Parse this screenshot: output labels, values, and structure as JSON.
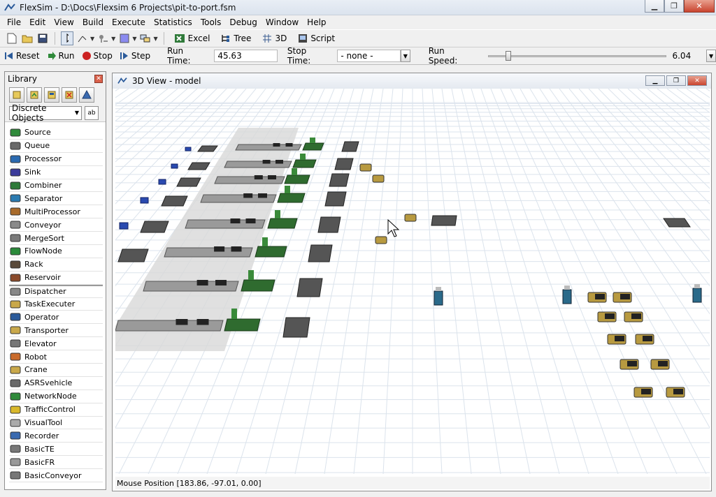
{
  "window": {
    "title": "FlexSim - D:\\Docs\\Flexsim 6 Projects\\pit-to-port.fsm"
  },
  "menu": [
    "File",
    "Edit",
    "View",
    "Build",
    "Execute",
    "Statistics",
    "Tools",
    "Debug",
    "Window",
    "Help"
  ],
  "toolbar": {
    "excel": "Excel",
    "tree": "Tree",
    "view3d": "3D",
    "script": "Script"
  },
  "run_controls": {
    "reset": "Reset",
    "run": "Run",
    "stop": "Stop",
    "step": "Step",
    "run_time_label": "Run Time:",
    "run_time_value": "45.63",
    "stop_time_label": "Stop Time:",
    "stop_time_value": "- none -",
    "run_speed_label": "Run Speed:",
    "run_speed_value": "6.04",
    "run_speed_fraction": 0.1
  },
  "library": {
    "title": "Library",
    "category": "Discrete Objects",
    "ab_label": "ab",
    "items": [
      {
        "label": "Source",
        "icon": "source-icon"
      },
      {
        "label": "Queue",
        "icon": "queue-icon"
      },
      {
        "label": "Processor",
        "icon": "processor-icon"
      },
      {
        "label": "Sink",
        "icon": "sink-icon"
      },
      {
        "label": "Combiner",
        "icon": "combiner-icon"
      },
      {
        "label": "Separator",
        "icon": "separator-icon"
      },
      {
        "label": "MultiProcessor",
        "icon": "multiprocessor-icon"
      },
      {
        "label": "Conveyor",
        "icon": "conveyor-icon"
      },
      {
        "label": "MergeSort",
        "icon": "mergesort-icon"
      },
      {
        "label": "FlowNode",
        "icon": "flownode-icon"
      },
      {
        "label": "Rack",
        "icon": "rack-icon"
      },
      {
        "label": "Reservoir",
        "icon": "reservoir-icon"
      },
      {
        "label": "Dispatcher",
        "icon": "dispatcher-icon"
      },
      {
        "label": "TaskExecuter",
        "icon": "taskexecuter-icon"
      },
      {
        "label": "Operator",
        "icon": "operator-icon"
      },
      {
        "label": "Transporter",
        "icon": "transporter-icon"
      },
      {
        "label": "Elevator",
        "icon": "elevator-icon"
      },
      {
        "label": "Robot",
        "icon": "robot-icon"
      },
      {
        "label": "Crane",
        "icon": "crane-icon"
      },
      {
        "label": "ASRSvehicle",
        "icon": "asrsvehicle-icon"
      },
      {
        "label": "NetworkNode",
        "icon": "networknode-icon"
      },
      {
        "label": "TrafficControl",
        "icon": "trafficcontrol-icon"
      },
      {
        "label": "VisualTool",
        "icon": "visualtool-icon"
      },
      {
        "label": "Recorder",
        "icon": "recorder-icon"
      },
      {
        "label": "BasicTE",
        "icon": "basicte-icon"
      },
      {
        "label": "BasicFR",
        "icon": "basicfr-icon"
      },
      {
        "label": "BasicConveyor",
        "icon": "basicconveyor-icon"
      }
    ]
  },
  "view3d": {
    "title": "3D View - model",
    "status": "Mouse Position [183.86, -97.01, 0.00]"
  },
  "colors": {
    "accent": "#2a5a9a",
    "grid": "#dbe3ec",
    "conveyor": "#9a9a9a",
    "processor": "#2f6b2f",
    "truck": "#b89a40"
  }
}
